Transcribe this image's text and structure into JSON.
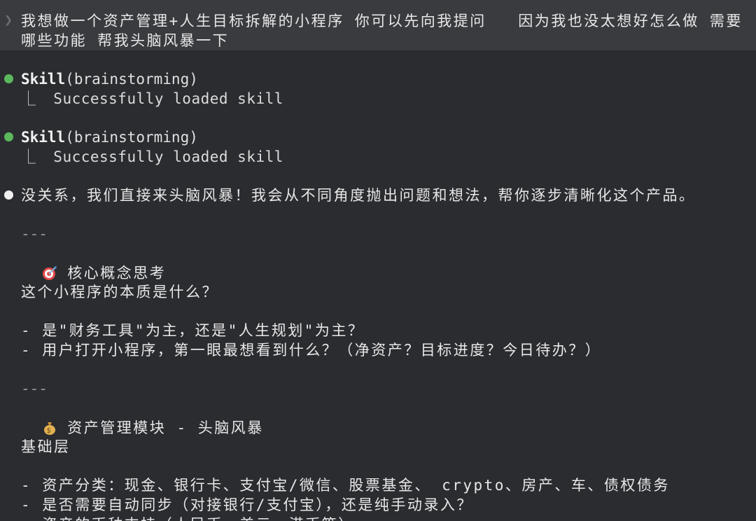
{
  "prompt": {
    "caret": "❯",
    "text": "我想做一个资产管理+人生目标拆解的小程序 你可以先向我提问   因为我也没太想好怎么做 需要哪些功能 帮我头脑风暴一下"
  },
  "tool_calls": [
    {
      "name": "Skill",
      "args": "(brainstorming)",
      "branch": "⎿",
      "result": "Successfully loaded skill"
    },
    {
      "name": "Skill",
      "args": "(brainstorming)",
      "branch": "⎿",
      "result": "Successfully loaded skill"
    }
  ],
  "response": {
    "intro": "没关系，我们直接来头脑风暴！我会从不同角度抛出问题和想法，帮你逐步清晰化这个产品。",
    "rule1": "---",
    "section1_icon": "target-icon",
    "section1_heading": "核心概念思考",
    "section1_question": "这个小程序的本质是什么？",
    "section1_items": [
      "- 是\"财务工具\"为主，还是\"人生规划\"为主？",
      "- 用户打开小程序，第一眼最想看到什么？（净资产？目标进度？今日待办？）"
    ],
    "rule2": "---",
    "section2_icon": "money-bag-icon",
    "section2_heading": "资产管理模块 - 头脑风暴",
    "section2_sub": "基础层",
    "section2_items": [
      "- 资产分类：现金、银行卡、支付宝/微信、股票基金、 crypto、房产、车、债权债务",
      "- 是否需要自动同步（对接银行/支付宝），还是纯手动录入？",
      "- 资产的币种支持（人民币、美元、港币等）"
    ]
  }
}
